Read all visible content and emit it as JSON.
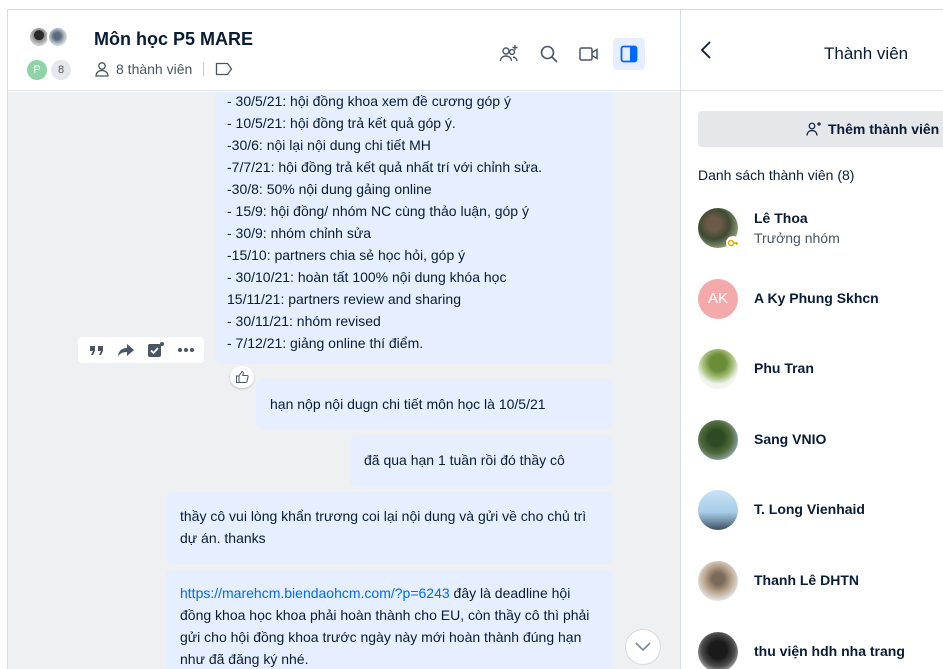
{
  "chat": {
    "title": "Môn học P5 MARE",
    "avatar_badge_letter": "P",
    "avatar_badge_count": "8",
    "member_count_label": "8 thành viên"
  },
  "messages": {
    "schedule_lines": [
      "- 30/5/21: hội đồng khoa xem đề cương góp ý",
      "- 10/5/21: hội đồng trả kết quả góp ý.",
      "-30/6: nội lại nội dung chi tiết MH",
      "-7/7/21: hội đồng trả kết quả nhất trí với chỉnh sửa.",
      "-30/8: 50% nội dung gảing online",
      "- 15/9: hội đồng/ nhóm NC cùng  thảo luận, góp ý",
      "- 30/9: nhóm chỉnh sửa",
      "-15/10: partners chia sẻ học hỏi, góp ý",
      "- 30/10/21: hoàn tất 100% nội dung khóa học",
      "15/11/21: partners review and sharing",
      "- 30/11/21: nhóm revised",
      "- 7/12/21: giảng online thí điểm."
    ],
    "msg2": "hạn nộp nội dugn chi tiết môn học là 10/5/21",
    "msg3": "đã qua hạn 1 tuần rồi đó thầy cô",
    "msg4": "thầy cô vui lòng khẩn trương coi lại nội dung và gửi về cho chủ trì dự án. thanks",
    "msg5_link": "https://marehcm.biendaohcm.com/?p=6243",
    "msg5_text": " đây là deadline hội đồng khoa học khoa phải hoàn thành cho EU, còn thầy cô thì phải gửi cho hội đồng khoa trước ngày này mới hoàn thành đúng hạn như đã đăng ký nhé."
  },
  "panel": {
    "title": "Thành viên",
    "add_member_label": "Thêm thành viên",
    "list_title": "Danh sách thành viên (8)",
    "members": [
      {
        "name": "Lê Thoa",
        "role": "Trưởng nhóm"
      },
      {
        "name": "A Ky Phung Skhcn",
        "initials": "AK"
      },
      {
        "name": "Phu Tran"
      },
      {
        "name": "Sang VNIO"
      },
      {
        "name": "T. Long Vienhaid"
      },
      {
        "name": "Thanh Lê DHTN"
      },
      {
        "name": "thu viện hdh nha trang"
      }
    ]
  },
  "icons": {
    "header": [
      "add-member-icon",
      "search-icon",
      "video-call-icon",
      "sidebar-toggle-icon"
    ],
    "message_actions": [
      "quote-icon",
      "forward-icon",
      "task-icon",
      "more-icon"
    ],
    "accent": "#0068ff"
  }
}
